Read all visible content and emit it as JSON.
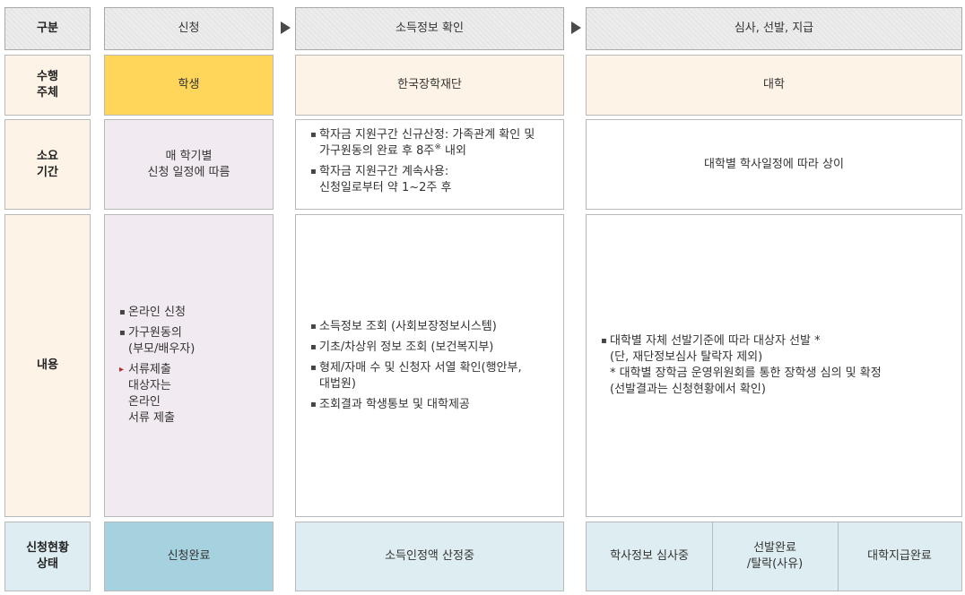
{
  "header": {
    "category": "구분",
    "apply": "신청",
    "income_check": "소득정보 확인",
    "review": "심사, 선발, 지급"
  },
  "agent_row": {
    "label": "수행\n주체",
    "apply": "학생",
    "income_check": "한국장학재단",
    "review": "대학"
  },
  "duration_row": {
    "label": "소요\n기간",
    "apply": "매 학기별\n신청 일정에 따름",
    "income_check": [
      {
        "text": "학자금 지원구간 신규산정: 가족관계 확인 및\n가구원동의 완료 후 8주",
        "sup": "※",
        "tail": " 내외"
      },
      {
        "text": "학자금 지원구간 계속사용:\n신청일로부터 약 1~2주 후"
      }
    ],
    "review": "대학별 학사일정에 따라 상이"
  },
  "content_row": {
    "label": "내용",
    "apply": [
      {
        "text": "온라인 신청",
        "bullet": "▪"
      },
      {
        "text": "가구원동의\n(부모/배우자)",
        "bullet": "▪"
      },
      {
        "text": "서류제출\n대상자는\n온라인\n서류 제출",
        "bullet": "▸"
      }
    ],
    "income_check": [
      "소득정보 조회 (사회보장정보시스템)",
      "기초/차상위 정보 조회 (보건복지부)",
      "형제/자매 수 및 신청자 서열 확인(행안부,\n대법원)",
      "조회결과 학생통보 및 대학제공"
    ],
    "review": "대학별 자체 선발기준에 따라 대상자 선발 *\n(단, 재단정보심사 탈락자 제외)\n* 대학별 장학금 운영위원회를 통한 장학생 심의 및 확정\n(선발결과는 신청현황에서 확인)"
  },
  "status_row": {
    "label": "신청현황\n상태",
    "apply": "신청완료",
    "income_check": "소득인정액 산정중",
    "review": [
      "학사정보 심사중",
      "선발완료\n/탈락(사유)",
      "대학지급완료"
    ]
  },
  "colors": {
    "header_bg": "#ececec",
    "label_bg": "#fdf3e6",
    "student_bg": "#ffd659",
    "apply_col_bg": "#f1ebf1",
    "status_dark": "#a6d1de",
    "status_light": "#deedf2",
    "border": "#b9b9b9",
    "arrow": "#4a4a4a",
    "red_bullet": "#c0272d"
  }
}
